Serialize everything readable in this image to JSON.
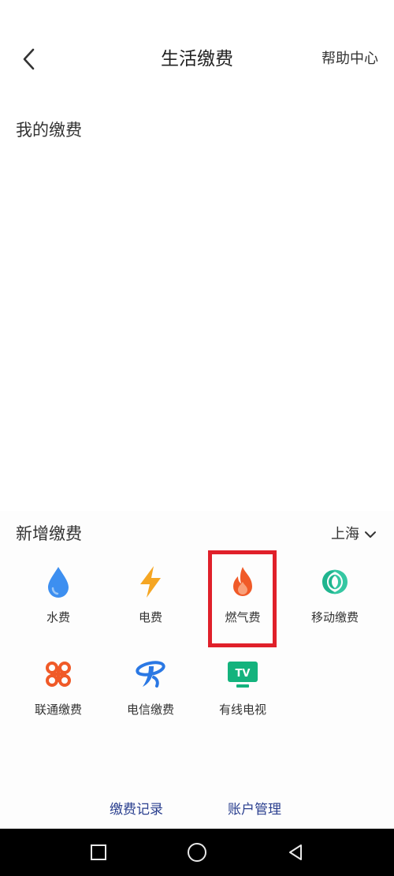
{
  "header": {
    "back_icon": "chevron-left-icon",
    "title": "生活缴费",
    "help_label": "帮助中心"
  },
  "my_payments": {
    "title": "我的缴费"
  },
  "new_payments": {
    "title": "新增缴费",
    "city": "上海",
    "items": [
      {
        "label": "水费",
        "icon": "water-drop-icon",
        "color": "#3d8ff0"
      },
      {
        "label": "电费",
        "icon": "lightning-icon",
        "color": "#f5a623"
      },
      {
        "label": "燃气费",
        "icon": "flame-icon",
        "color": "#f05a28"
      },
      {
        "label": "移动缴费",
        "icon": "china-mobile-icon",
        "color": "#1fb58f"
      },
      {
        "label": "联通缴费",
        "icon": "china-unicom-icon",
        "color": "#f05a28"
      },
      {
        "label": "电信缴费",
        "icon": "china-telecom-icon",
        "color": "#2a78e4"
      },
      {
        "label": "有线电视",
        "icon": "tv-icon",
        "color": "#14b37d"
      }
    ]
  },
  "footer": {
    "records_label": "缴费记录",
    "account_label": "账户管理"
  },
  "navbar": {
    "square_icon": "square-nav-icon",
    "home_icon": "circle-home-icon",
    "back_icon": "triangle-back-icon"
  },
  "highlight_color": "#e0202a"
}
